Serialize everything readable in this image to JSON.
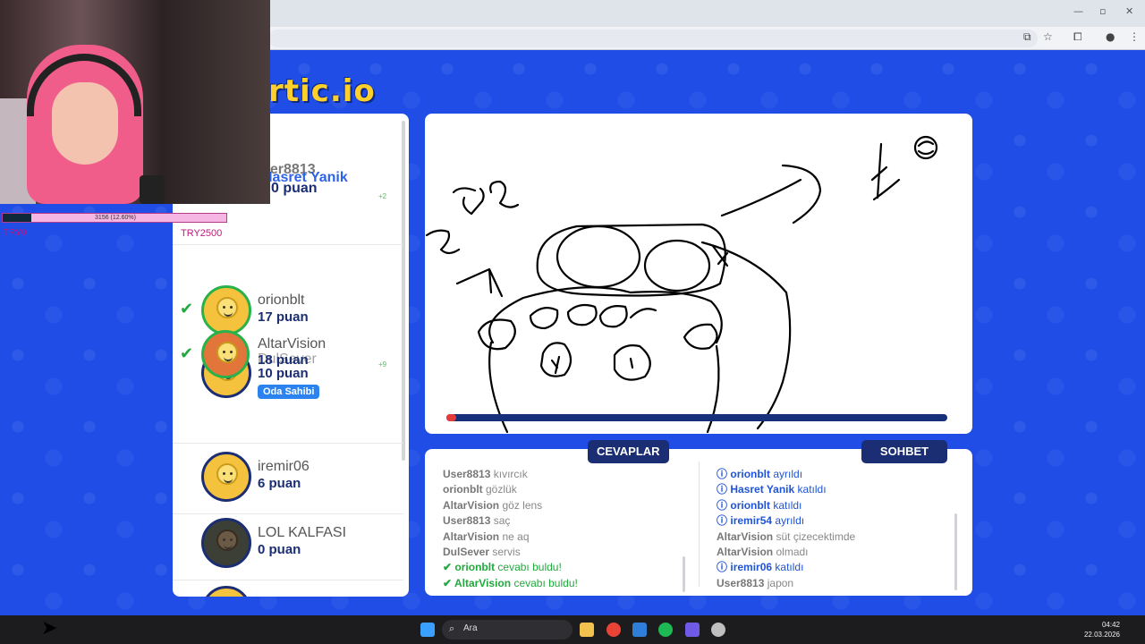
{
  "logo": "rtic.io",
  "players": [
    {
      "name": "orionblt",
      "points": "17 puan",
      "guessed": true
    },
    {
      "name": "AltarVision",
      "points": "18 puan",
      "guessed": true
    },
    {
      "name": "DulSever",
      "points": "10 puan",
      "owner_badge": "Oda Sahibi"
    },
    {
      "name": "iremir06",
      "points": "6 puan"
    },
    {
      "name": "LOL KALFASI",
      "points": "0 puan"
    }
  ],
  "ghosts": {
    "user8813": "ser8813",
    "hasret": "Hasret Yanik",
    "points_top": "0 puan",
    "plus2": "+2",
    "plus9": "+9"
  },
  "tabs": {
    "answers": "CEVAPLAR",
    "chat": "SOHBET"
  },
  "answers": [
    {
      "user": "User8813",
      "text": "kıvırcık",
      "kind": "msg"
    },
    {
      "user": "orionblt",
      "text": "gözlük",
      "kind": "msg"
    },
    {
      "user": "AltarVision",
      "text": "göz lens",
      "kind": "msg"
    },
    {
      "user": "User8813",
      "text": "saç",
      "kind": "msg"
    },
    {
      "user": "AltarVision",
      "text": "ne aq",
      "kind": "msg"
    },
    {
      "user": "DulSever",
      "text": "servis",
      "kind": "msg"
    },
    {
      "user": "orionblt",
      "text": "cevabı buldu!",
      "kind": "found"
    },
    {
      "user": "AltarVision",
      "text": "cevabı buldu!",
      "kind": "found"
    }
  ],
  "chat": [
    {
      "user": "orionblt",
      "text": "ayrıldı",
      "kind": "info"
    },
    {
      "user": "Hasret Yanik",
      "text": "katıldı",
      "kind": "info"
    },
    {
      "user": "orionblt",
      "text": "katıldı",
      "kind": "info"
    },
    {
      "user": "iremir54",
      "text": "ayrıldı",
      "kind": "info"
    },
    {
      "user": "AltarVision",
      "text": "süt çizecektimde",
      "kind": "msg"
    },
    {
      "user": "AltarVision",
      "text": "olmadı",
      "kind": "msg"
    },
    {
      "user": "iremir06",
      "text": "katıldı",
      "kind": "info"
    },
    {
      "user": "User8813",
      "text": "japon",
      "kind": "msg"
    }
  ],
  "timer_progress": 0.02,
  "stream": {
    "bar_text": "3156 (12.60%)",
    "bar_progress": 0.126,
    "try_left": "TRY0",
    "try_right": "TRY2500"
  },
  "taskbar": {
    "search_placeholder": "Ara",
    "time": "04:42",
    "date": "22.03.2026"
  },
  "colors": {
    "page_bg": "#1f4de6",
    "navy": "#1b2d73",
    "green": "#20a93c",
    "logo_yellow": "#ffd02b"
  }
}
